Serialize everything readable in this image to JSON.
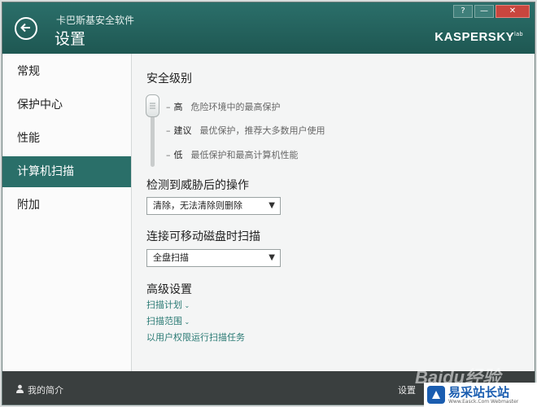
{
  "header": {
    "app_name": "卡巴斯基安全软件",
    "title": "设置",
    "brand": "KASPERSKY",
    "brand_suffix": "lab",
    "window_buttons": {
      "help": "?",
      "minimize": "—",
      "close": "✕"
    },
    "color": "#2a6f69"
  },
  "sidebar": {
    "items": [
      {
        "label": "常规"
      },
      {
        "label": "保护中心"
      },
      {
        "label": "性能"
      },
      {
        "label": "计算机扫描",
        "active": true
      },
      {
        "label": "附加"
      }
    ]
  },
  "main": {
    "security_level": {
      "title": "安全级别",
      "selected": "高",
      "levels": [
        {
          "name": "高",
          "desc": "危险环境中的最高保护"
        },
        {
          "name": "建议",
          "desc": "最优保护，推荐大多数用户使用"
        },
        {
          "name": "低",
          "desc": "最低保护和最高计算机性能"
        }
      ]
    },
    "threat_action": {
      "title": "检测到威胁后的操作",
      "value": "清除，无法清除则删除"
    },
    "removable_scan": {
      "title": "连接可移动磁盘时扫描",
      "value": "全盘扫描"
    },
    "advanced": {
      "title": "高级设置",
      "links": [
        "扫描计划",
        "扫描范围",
        "以用户权限运行扫描任务"
      ]
    }
  },
  "footer": {
    "profile": "我的简介",
    "settings": "设置"
  },
  "watermarks": {
    "baidu": "Baidu经验",
    "site_name": "易采站长站",
    "site_url": "Www.Easck.Com Webmaster"
  }
}
